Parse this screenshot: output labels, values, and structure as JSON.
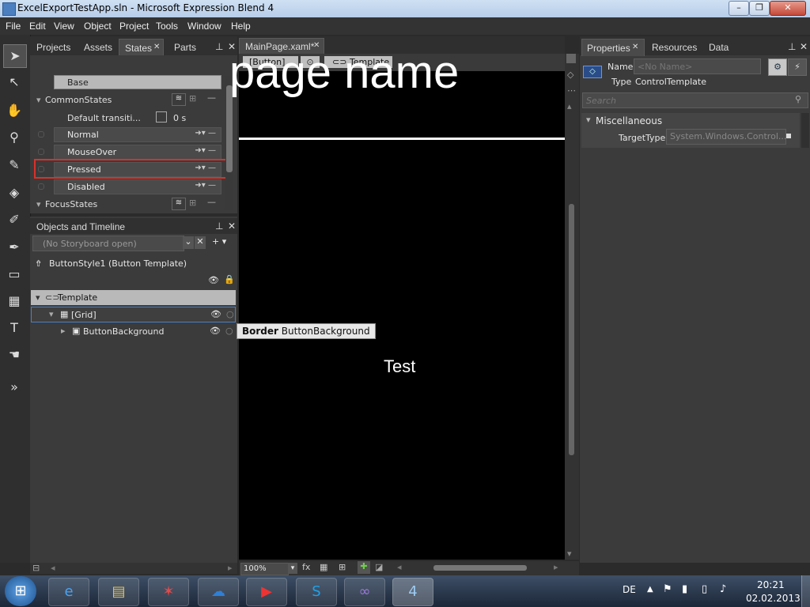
{
  "window": {
    "title": "ExcelExportTestApp.sln - Microsoft Expression Blend 4",
    "min_label": "–",
    "max_label": "❐",
    "close_label": "✕"
  },
  "menu": [
    "File",
    "Edit",
    "View",
    "Object",
    "Project",
    "Tools",
    "Window",
    "Help"
  ],
  "left_tabs": {
    "projects": "Projects",
    "assets": "Assets",
    "states": "States",
    "parts": "Parts",
    "states_close": "✕"
  },
  "states": {
    "base": "Base",
    "group1": "CommonStates",
    "default_transition": "Default transiti...",
    "transition_time": "0 s",
    "items": [
      "Normal",
      "MouseOver",
      "Pressed",
      "Disabled"
    ],
    "group2": "FocusStates"
  },
  "objects": {
    "header": "Objects and Timeline",
    "storyboard_placeholder": "(No Storyboard open)",
    "scope": "ButtonStyle1 (Button Template)",
    "tree": {
      "template": "Template",
      "grid": "[Grid]",
      "child": "ButtonBackground"
    }
  },
  "doc": {
    "tab": "MainPage.xaml*",
    "breadcrumb": {
      "button": "[Button]",
      "template": "Template"
    },
    "heading": "page name",
    "button_text": "Test",
    "tooltip_type": "Border",
    "tooltip_name": "ButtonBackground",
    "zoom": "100%"
  },
  "properties": {
    "tabs": {
      "properties": "Properties",
      "resources": "Resources",
      "data": "Data",
      "close": "✕"
    },
    "name_label": "Name",
    "name_placeholder": "<No Name>",
    "type_label": "Type",
    "type_value": "ControlTemplate",
    "search_placeholder": "Search",
    "category": "Miscellaneous",
    "target_label": "TargetType",
    "target_value": "System.Windows.Control..."
  },
  "taskbar": {
    "lang": "DE",
    "time": "20:21",
    "date": "02.02.2013"
  },
  "icons": {
    "selection": "selection-arrow-icon",
    "hand": "pan-icon",
    "zoom": "zoom-icon",
    "eyedropper": "eyedropper-icon",
    "paintbucket": "paint-bucket-icon",
    "brush": "brush-icon",
    "pen": "pen-icon",
    "rect": "rectangle-icon",
    "grid": "grid-icon",
    "text": "text-icon",
    "control": "control-icon",
    "more": "more-assets-icon"
  },
  "colors": {
    "highlight": "#d9312a",
    "canvas": "#000000",
    "panel": "#3b3b3b"
  }
}
